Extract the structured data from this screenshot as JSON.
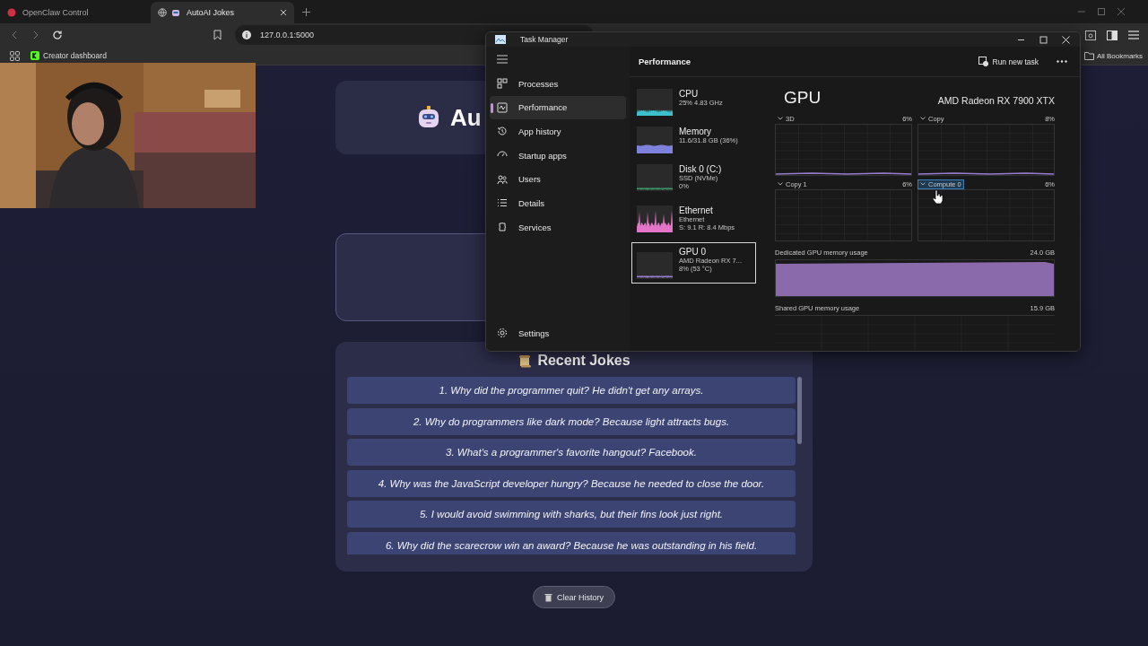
{
  "browser": {
    "tabs": [
      {
        "title": "OpenClaw Control",
        "selected": false,
        "kind": "app"
      },
      {
        "title": "AutoAI Jokes",
        "selected": true,
        "kind": "web"
      }
    ],
    "address": "127.0.0.1:5000",
    "bookmarks": [
      {
        "label": "Creator dashboard"
      }
    ],
    "all_bookmarks": "All Bookmarks"
  },
  "page": {
    "header_title": "Au",
    "jokes_title": "Recent Jokes",
    "jokes": [
      "1. Why did the programmer quit? He didn't get any arrays.",
      "2. Why do programmers like dark mode? Because light attracts bugs.",
      "3. What's a programmer's favorite hangout? Facebook.",
      "4. Why was the JavaScript developer hungry? Because he needed to close the door.",
      "5. I would avoid swimming with sharks, but their fins look just right.",
      "6. Why did the scarecrow win an award? Because he was outstanding in his field."
    ],
    "clear_button": "Clear History"
  },
  "task_manager": {
    "title": "Task Manager",
    "nav": [
      {
        "label": "Processes",
        "selected": false,
        "kind": "processes"
      },
      {
        "label": "Performance",
        "selected": true,
        "kind": "performance"
      },
      {
        "label": "App history",
        "selected": false,
        "kind": "history"
      },
      {
        "label": "Startup apps",
        "selected": false,
        "kind": "startup"
      },
      {
        "label": "Users",
        "selected": false,
        "kind": "users"
      },
      {
        "label": "Details",
        "selected": false,
        "kind": "details"
      },
      {
        "label": "Services",
        "selected": false,
        "kind": "services"
      }
    ],
    "settings": "Settings",
    "section_title": "Performance",
    "run_new_task": "Run new task",
    "devices": [
      {
        "name": "CPU",
        "lines": [
          "25%  4.83 GHz"
        ],
        "selected": false,
        "color": "#3cc0cc",
        "kind": "spiky"
      },
      {
        "name": "Memory",
        "lines": [
          "11.6/31.8 GB (36%)"
        ],
        "selected": false,
        "color": "#7e82dc",
        "kind": "filled"
      },
      {
        "name": "Disk 0 (C:)",
        "lines": [
          "SSD (NVMe)",
          "0%"
        ],
        "selected": false,
        "color": "#3a9a6a",
        "kind": "flat"
      },
      {
        "name": "Ethernet",
        "lines": [
          "Ethernet",
          "S: 9.1  R: 8.4 Mbps"
        ],
        "selected": false,
        "color": "#e474c8",
        "kind": "peaks"
      },
      {
        "name": "GPU 0",
        "lines": [
          "AMD Radeon RX 7...",
          "8%  (53 °C)"
        ],
        "selected": true,
        "color": "#9a7cd0",
        "kind": "flat"
      }
    ],
    "detail": {
      "title": "GPU",
      "model": "AMD Radeon RX 7900 XTX",
      "engines": [
        {
          "name": "3D",
          "value": "6%",
          "selected": false
        },
        {
          "name": "Copy",
          "value": "8%",
          "selected": false
        },
        {
          "name": "Copy 1",
          "value": "6%",
          "selected": false
        },
        {
          "name": "Compute 0",
          "value": "6%",
          "selected": true
        }
      ],
      "dedicated_label": "Dedicated GPU memory usage",
      "dedicated_value": "24.0 GB",
      "shared_label": "Shared GPU memory usage",
      "shared_value": "15.9 GB"
    }
  }
}
